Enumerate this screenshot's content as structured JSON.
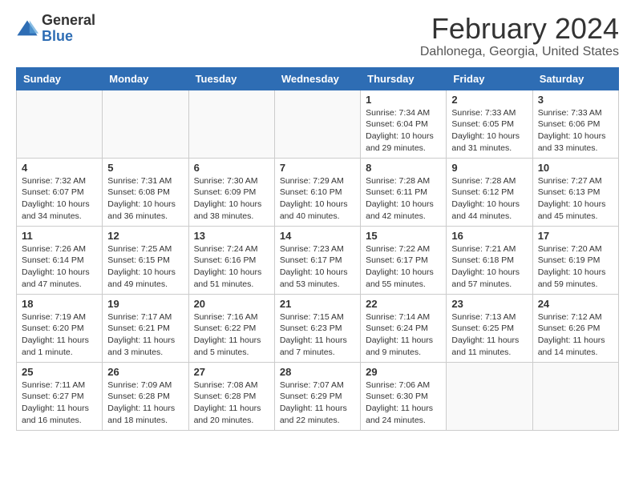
{
  "logo": {
    "general": "General",
    "blue": "Blue"
  },
  "header": {
    "title": "February 2024",
    "subtitle": "Dahlonega, Georgia, United States"
  },
  "calendar": {
    "weekdays": [
      "Sunday",
      "Monday",
      "Tuesday",
      "Wednesday",
      "Thursday",
      "Friday",
      "Saturday"
    ],
    "weeks": [
      [
        {
          "day": "",
          "info": ""
        },
        {
          "day": "",
          "info": ""
        },
        {
          "day": "",
          "info": ""
        },
        {
          "day": "",
          "info": ""
        },
        {
          "day": "1",
          "info": "Sunrise: 7:34 AM\nSunset: 6:04 PM\nDaylight: 10 hours\nand 29 minutes."
        },
        {
          "day": "2",
          "info": "Sunrise: 7:33 AM\nSunset: 6:05 PM\nDaylight: 10 hours\nand 31 minutes."
        },
        {
          "day": "3",
          "info": "Sunrise: 7:33 AM\nSunset: 6:06 PM\nDaylight: 10 hours\nand 33 minutes."
        }
      ],
      [
        {
          "day": "4",
          "info": "Sunrise: 7:32 AM\nSunset: 6:07 PM\nDaylight: 10 hours\nand 34 minutes."
        },
        {
          "day": "5",
          "info": "Sunrise: 7:31 AM\nSunset: 6:08 PM\nDaylight: 10 hours\nand 36 minutes."
        },
        {
          "day": "6",
          "info": "Sunrise: 7:30 AM\nSunset: 6:09 PM\nDaylight: 10 hours\nand 38 minutes."
        },
        {
          "day": "7",
          "info": "Sunrise: 7:29 AM\nSunset: 6:10 PM\nDaylight: 10 hours\nand 40 minutes."
        },
        {
          "day": "8",
          "info": "Sunrise: 7:28 AM\nSunset: 6:11 PM\nDaylight: 10 hours\nand 42 minutes."
        },
        {
          "day": "9",
          "info": "Sunrise: 7:28 AM\nSunset: 6:12 PM\nDaylight: 10 hours\nand 44 minutes."
        },
        {
          "day": "10",
          "info": "Sunrise: 7:27 AM\nSunset: 6:13 PM\nDaylight: 10 hours\nand 45 minutes."
        }
      ],
      [
        {
          "day": "11",
          "info": "Sunrise: 7:26 AM\nSunset: 6:14 PM\nDaylight: 10 hours\nand 47 minutes."
        },
        {
          "day": "12",
          "info": "Sunrise: 7:25 AM\nSunset: 6:15 PM\nDaylight: 10 hours\nand 49 minutes."
        },
        {
          "day": "13",
          "info": "Sunrise: 7:24 AM\nSunset: 6:16 PM\nDaylight: 10 hours\nand 51 minutes."
        },
        {
          "day": "14",
          "info": "Sunrise: 7:23 AM\nSunset: 6:17 PM\nDaylight: 10 hours\nand 53 minutes."
        },
        {
          "day": "15",
          "info": "Sunrise: 7:22 AM\nSunset: 6:17 PM\nDaylight: 10 hours\nand 55 minutes."
        },
        {
          "day": "16",
          "info": "Sunrise: 7:21 AM\nSunset: 6:18 PM\nDaylight: 10 hours\nand 57 minutes."
        },
        {
          "day": "17",
          "info": "Sunrise: 7:20 AM\nSunset: 6:19 PM\nDaylight: 10 hours\nand 59 minutes."
        }
      ],
      [
        {
          "day": "18",
          "info": "Sunrise: 7:19 AM\nSunset: 6:20 PM\nDaylight: 11 hours\nand 1 minute."
        },
        {
          "day": "19",
          "info": "Sunrise: 7:17 AM\nSunset: 6:21 PM\nDaylight: 11 hours\nand 3 minutes."
        },
        {
          "day": "20",
          "info": "Sunrise: 7:16 AM\nSunset: 6:22 PM\nDaylight: 11 hours\nand 5 minutes."
        },
        {
          "day": "21",
          "info": "Sunrise: 7:15 AM\nSunset: 6:23 PM\nDaylight: 11 hours\nand 7 minutes."
        },
        {
          "day": "22",
          "info": "Sunrise: 7:14 AM\nSunset: 6:24 PM\nDaylight: 11 hours\nand 9 minutes."
        },
        {
          "day": "23",
          "info": "Sunrise: 7:13 AM\nSunset: 6:25 PM\nDaylight: 11 hours\nand 11 minutes."
        },
        {
          "day": "24",
          "info": "Sunrise: 7:12 AM\nSunset: 6:26 PM\nDaylight: 11 hours\nand 14 minutes."
        }
      ],
      [
        {
          "day": "25",
          "info": "Sunrise: 7:11 AM\nSunset: 6:27 PM\nDaylight: 11 hours\nand 16 minutes."
        },
        {
          "day": "26",
          "info": "Sunrise: 7:09 AM\nSunset: 6:28 PM\nDaylight: 11 hours\nand 18 minutes."
        },
        {
          "day": "27",
          "info": "Sunrise: 7:08 AM\nSunset: 6:28 PM\nDaylight: 11 hours\nand 20 minutes."
        },
        {
          "day": "28",
          "info": "Sunrise: 7:07 AM\nSunset: 6:29 PM\nDaylight: 11 hours\nand 22 minutes."
        },
        {
          "day": "29",
          "info": "Sunrise: 7:06 AM\nSunset: 6:30 PM\nDaylight: 11 hours\nand 24 minutes."
        },
        {
          "day": "",
          "info": ""
        },
        {
          "day": "",
          "info": ""
        }
      ]
    ]
  }
}
